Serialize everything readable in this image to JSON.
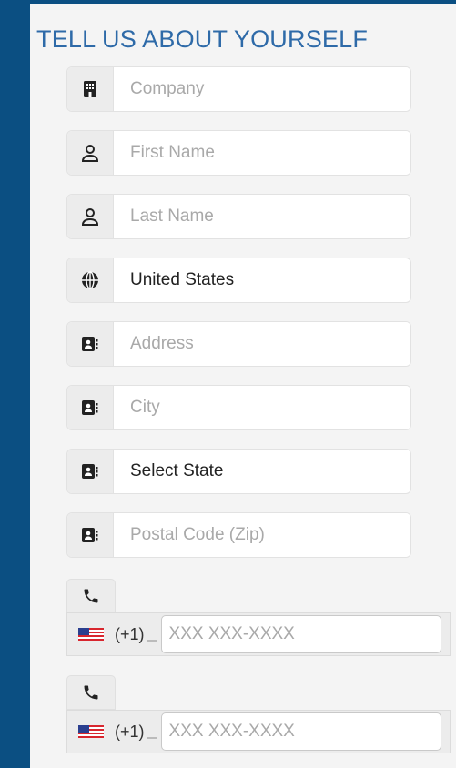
{
  "form": {
    "title": "TELL US ABOUT YOURSELF",
    "fields": [
      {
        "icon": "building-icon",
        "placeholder": "Company",
        "value": ""
      },
      {
        "icon": "user-icon",
        "placeholder": "First Name",
        "value": ""
      },
      {
        "icon": "user-icon",
        "placeholder": "Last Name",
        "value": ""
      },
      {
        "icon": "globe-icon",
        "placeholder": "",
        "value": "United States"
      },
      {
        "icon": "address-book-icon",
        "placeholder": "Address",
        "value": ""
      },
      {
        "icon": "address-book-icon",
        "placeholder": "City",
        "value": ""
      },
      {
        "icon": "address-book-icon",
        "placeholder": "",
        "value": "Select State"
      },
      {
        "icon": "address-book-icon",
        "placeholder": "Postal Code (Zip)",
        "value": ""
      }
    ],
    "phones": [
      {
        "icon": "phone-icon",
        "flag": "us-flag-icon",
        "dial_code": "(+1)",
        "placeholder": "XXX XXX-XXXX"
      },
      {
        "icon": "phone-icon",
        "flag": "us-flag-icon",
        "dial_code": "(+1)",
        "placeholder": "XXX XXX-XXXX"
      }
    ]
  },
  "colors": {
    "background": "#0b4f82",
    "title": "#2e6aa8",
    "panel": "#f4f4f4"
  }
}
